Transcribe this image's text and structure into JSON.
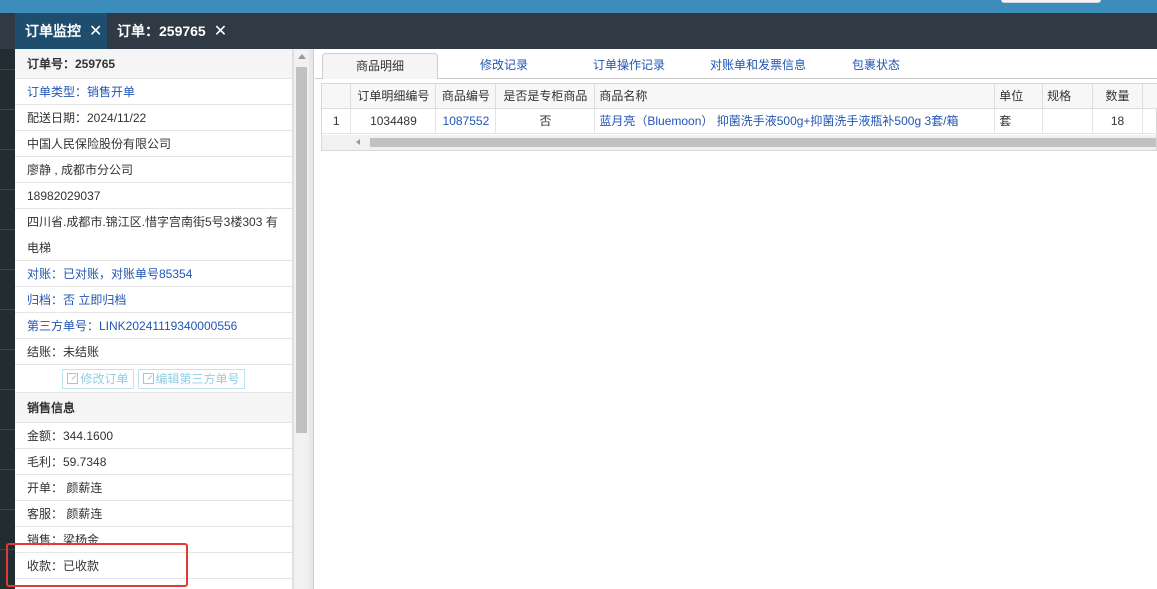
{
  "tabs": [
    {
      "label": "订单监控",
      "close": "✕"
    },
    {
      "label": "订单：259765",
      "close": "✕"
    }
  ],
  "left_panel": {
    "order_no": "订单号：259765",
    "rows": [
      "订单类型：销售开单",
      "配送日期：2024/11/22",
      "中国人民保险股份有限公司",
      "廖静 , 成都市分公司",
      "18982029037",
      "四川省.成都市.锦江区.惜字宫南街5号3楼303 有电梯",
      "对账：已对账，对账单号85354",
      "归档：否 立即归档",
      "第三方单号：LINK20241119340000556",
      "结账：未结账"
    ],
    "actions": {
      "edit_order": "修改订单",
      "edit_third_party": "编辑第三方单号"
    },
    "sales_section": {
      "title": "销售信息",
      "rows": [
        "金额：344.1600",
        "毛利：59.7348",
        "开单： 颜薪连",
        "客服： 颜薪连",
        "销售：梁杨金",
        "收款：已收款"
      ]
    }
  },
  "sub_tabs": [
    "商品明细",
    "修改记录",
    "订单操作记录",
    "对账单和发票信息",
    "包裹状态"
  ],
  "table": {
    "headers": [
      "",
      "订单明细编号",
      "商品编号",
      "是否是专柜商品",
      "商品名称",
      "单位",
      "规格",
      "数量"
    ],
    "rows": [
      [
        "1",
        "1034489",
        "1087552",
        "否",
        "蓝月亮（Bluemoon） 抑菌洗手液500g+抑菌洗手液瓶补500g 3套/箱",
        "套",
        "",
        "18"
      ]
    ]
  },
  "colors": {
    "topbar": "#3c8dbc",
    "active_tab": "#1f4d6e",
    "link": "#2255b3",
    "highlight_box": "#e53935"
  }
}
